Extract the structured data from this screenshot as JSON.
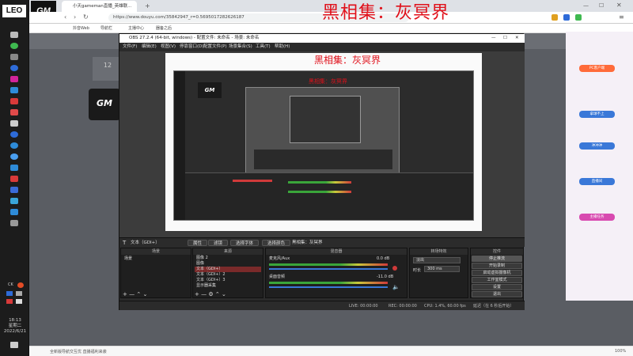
{
  "taskbar": {
    "logo": "LEO",
    "tray_label": "CK",
    "time": "18:13",
    "weekday": "星期二",
    "date": "2022/6/21"
  },
  "browser": {
    "tab_title": "小天gameman直播_英雄联...",
    "url": "https://www.douyu.com/35842947_r=0.5695017282626187",
    "bookmarks": [
      "抖音Web",
      "导航栏",
      "主播中心",
      "器备之后"
    ],
    "brand_logo": "GM",
    "status_left": "全新版导航交互优 直播福利来袭",
    "status_right": "100%"
  },
  "overlay_title": "黑相集：灰冥界",
  "page": {
    "left_card_number": "12",
    "gm_card": "GM",
    "right_buttons": [
      "PC客户端",
      "拿球不上",
      "冲冲冲",
      "直播间",
      "主播任务"
    ]
  },
  "obs": {
    "title": "OBS 27.2.4 (64-bit, windows) - 配置文件: 未命名 - 场景: 未命名",
    "menu": [
      "文件(F)",
      "编辑(E)",
      "视图(V)",
      "停靠窗口(D)",
      "配置文件(P)",
      "场景集合(S)",
      "工具(T)",
      "帮助(H)"
    ],
    "toolbar": {
      "source_name": "文本（GDI+）",
      "properties": "属性",
      "filters": "滤镜",
      "select_font": "选择字体",
      "select_color": "选择颜色",
      "text_label": "黑相集：灰冥界"
    },
    "docks": {
      "scenes_title": "场景",
      "scenes": [
        "场景"
      ],
      "sources_title": "来源",
      "sources": [
        "图像 2",
        "图像",
        "文本（GDI+）",
        "文本（GDI+）2",
        "文本（GDI+）3",
        "显示器采集"
      ],
      "mixer_title": "混音器",
      "mixer_tracks": [
        {
          "name": "麦克风/Aux",
          "level": "0.0 dB"
        },
        {
          "name": "桌面音频",
          "level": "-11.0 dB"
        }
      ],
      "transitions_title": "转场特效",
      "transition_type": "淡出",
      "duration_label": "时长",
      "duration_value": "300 ms",
      "controls_title": "控件",
      "controls": [
        "停止推流",
        "开始录制",
        "启动虚拟摄像机",
        "工作室模式",
        "设置",
        "退出"
      ]
    },
    "status": {
      "live": "LIVE: 00:00:00",
      "rec": "REC: 00:00:00",
      "cpu": "CPU: 1.4%, 60.00 fps",
      "stream": "延迟（在 6 秒后开始）"
    }
  }
}
